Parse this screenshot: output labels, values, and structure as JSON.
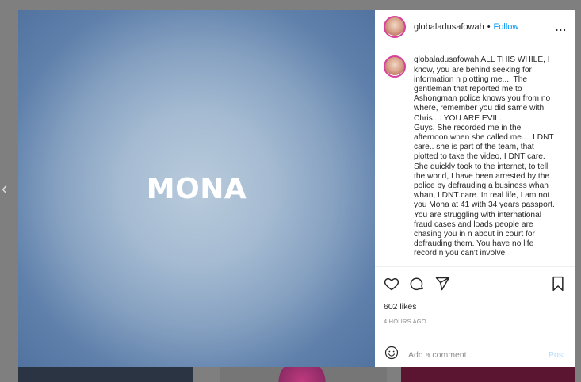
{
  "post": {
    "image_text": "MONA",
    "username": "globaladusafowah",
    "separator": "•",
    "follow_label": "Follow",
    "more_label": "...",
    "caption": "ALL THIS WHILE, I know, you are behind seeking for information n plotting me.... The gentleman that reported me to Ashongman police knows you from no where, remember you did same with Chris.... YOU ARE EVIL.",
    "caption_cont": "Guys, She recorded me in the afternoon when she called me.... I DNT care.. she is part of the team, that plotted to take the video, I DNT care. She quickly took to the internet, to tell the world, I have been arrested by the police by defrauding a business whan whan, I DNT care. In real life, I am not you Mona at 41 with 34 years passport. You are struggling with international fraud cases and loads people are chasing you in n about in court for defrauding them. You have no life record n you can't involve",
    "likes": "602 likes",
    "time": "4 HOURS AGO"
  },
  "comment": {
    "placeholder": "Add a comment...",
    "post_label": "Post"
  },
  "nav": {
    "prev_glyph": "‹"
  },
  "colors": {
    "accent": "#0095f6",
    "post_disabled": "#b3dbff",
    "media_bg": "#5f80ab"
  },
  "icons": [
    "heart-icon",
    "comment-icon",
    "share-icon",
    "bookmark-icon",
    "emoji-icon",
    "more-icon",
    "chevron-left-icon"
  ]
}
